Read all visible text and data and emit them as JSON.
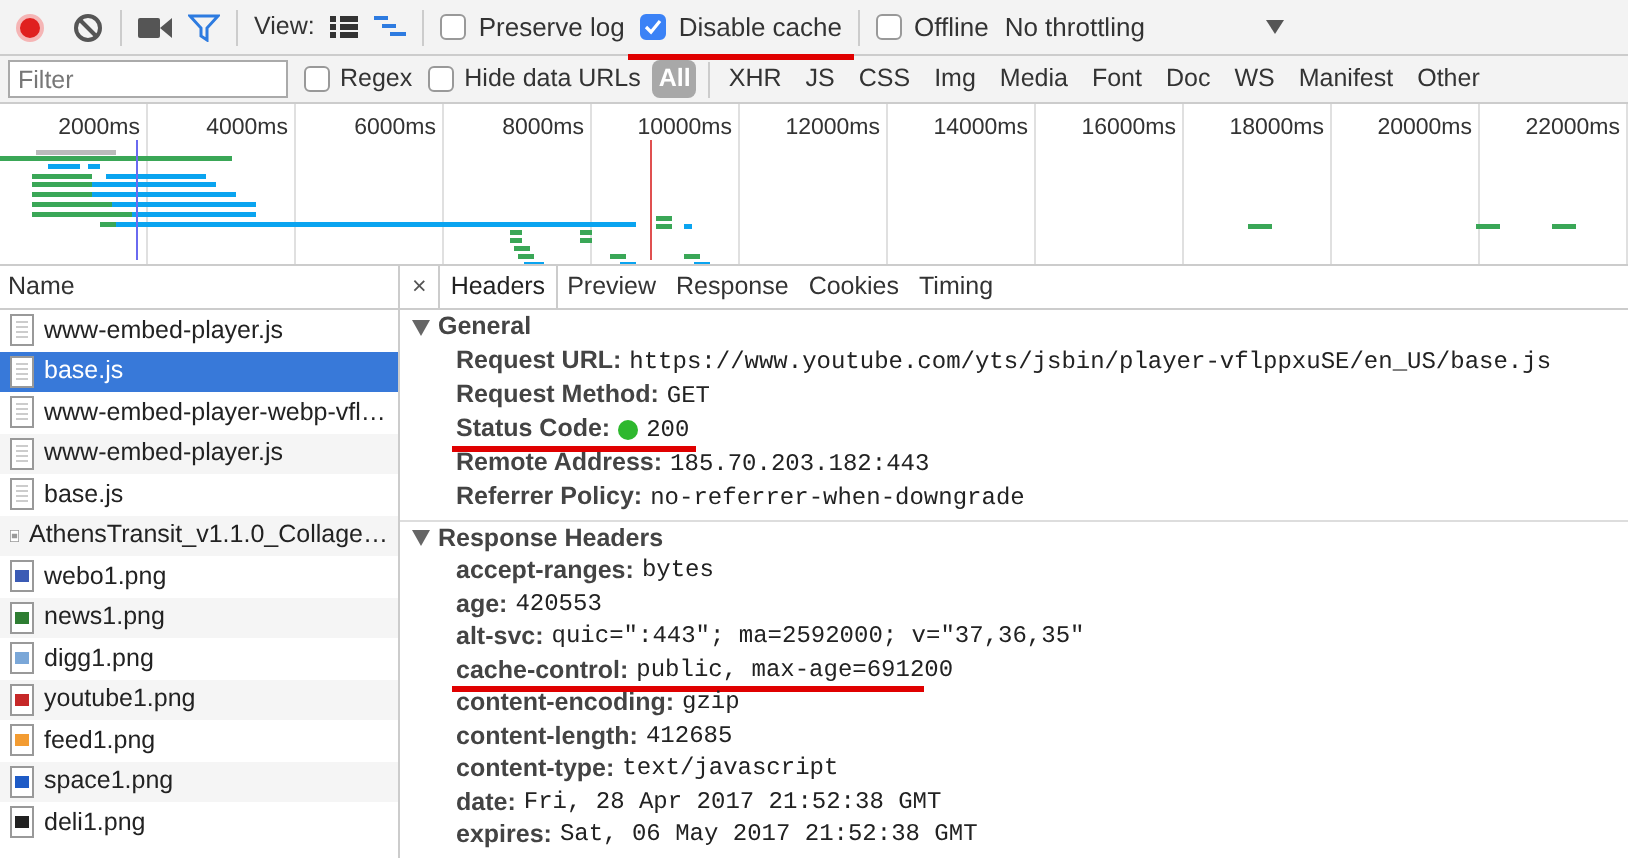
{
  "toolbar": {
    "recording": true,
    "view_label": "View:",
    "checkboxes": [
      {
        "label": "Preserve log",
        "checked": false
      },
      {
        "label": "Disable cache",
        "checked": true,
        "underlined": true
      },
      {
        "label": "Offline",
        "checked": false
      }
    ],
    "throttling": "No throttling"
  },
  "filter_bar": {
    "placeholder": "Filter",
    "checkboxes": [
      {
        "label": "Regex",
        "checked": false
      },
      {
        "label": "Hide data URLs",
        "checked": false
      }
    ],
    "types": [
      {
        "label": "All",
        "selected": true
      },
      {
        "label": "XHR",
        "selected": false
      },
      {
        "label": "JS",
        "selected": false
      },
      {
        "label": "CSS",
        "selected": false
      },
      {
        "label": "Img",
        "selected": false
      },
      {
        "label": "Media",
        "selected": false
      },
      {
        "label": "Font",
        "selected": false
      },
      {
        "label": "Doc",
        "selected": false
      },
      {
        "label": "WS",
        "selected": false
      },
      {
        "label": "Manifest",
        "selected": false
      },
      {
        "label": "Other",
        "selected": false
      }
    ]
  },
  "timeline": {
    "ticks": [
      "2000ms",
      "4000ms",
      "6000ms",
      "8000ms",
      "10000ms",
      "12000ms",
      "14000ms",
      "16000ms",
      "18000ms",
      "20000ms",
      "22000ms"
    ]
  },
  "requests": {
    "column": "Name",
    "rows": [
      {
        "name": "www-embed-player.js",
        "kind": "script",
        "selected": false
      },
      {
        "name": "base.js",
        "kind": "script",
        "selected": true
      },
      {
        "name": "www-embed-player-webp-vfl…",
        "kind": "script",
        "selected": false
      },
      {
        "name": "www-embed-player.js",
        "kind": "script",
        "selected": false
      },
      {
        "name": "base.js",
        "kind": "script",
        "selected": false
      },
      {
        "name": "AthensTransit_v1.1.0_Collage…",
        "kind": "image",
        "color": "#9a9a9a",
        "selected": false
      },
      {
        "name": "webo1.png",
        "kind": "image",
        "color": "#3b5bb5",
        "selected": false
      },
      {
        "name": "news1.png",
        "kind": "image",
        "color": "#2e7d32",
        "selected": false
      },
      {
        "name": "digg1.png",
        "kind": "image",
        "color": "#7aa7d8",
        "selected": false
      },
      {
        "name": "youtube1.png",
        "kind": "image",
        "color": "#c62828",
        "selected": false
      },
      {
        "name": "feed1.png",
        "kind": "image",
        "color": "#f39c32",
        "selected": false
      },
      {
        "name": "space1.png",
        "kind": "image",
        "color": "#1e5bc6",
        "selected": false
      },
      {
        "name": "deli1.png",
        "kind": "image",
        "color": "#222222",
        "selected": false
      }
    ]
  },
  "details": {
    "close": "×",
    "tabs": [
      {
        "label": "Headers",
        "selected": true
      },
      {
        "label": "Preview",
        "selected": false
      },
      {
        "label": "Response",
        "selected": false
      },
      {
        "label": "Cookies",
        "selected": false
      },
      {
        "label": "Timing",
        "selected": false
      }
    ],
    "sections": [
      {
        "title": "General",
        "expanded": true,
        "rows": [
          {
            "key": "Request URL:",
            "value": "https://www.youtube.com/yts/jsbin/player-vflppxuSE/en_US/base.js",
            "underlined": false
          },
          {
            "key": "Request Method:",
            "value": "GET",
            "underlined": false
          },
          {
            "key": "Status Code:",
            "value": "200",
            "color": "#2eb82e",
            "underlined": true
          },
          {
            "key": "Remote Address:",
            "value": "185.70.203.182:443",
            "underlined": false
          },
          {
            "key": "Referrer Policy:",
            "value": "no-referrer-when-downgrade",
            "underlined": false
          }
        ]
      },
      {
        "title": "Response Headers",
        "expanded": true,
        "rows": [
          {
            "key": "accept-ranges:",
            "value": "bytes",
            "underlined": false
          },
          {
            "key": "age:",
            "value": "420553",
            "underlined": false
          },
          {
            "key": "alt-svc:",
            "value": "quic=\":443\"; ma=2592000; v=\"37,36,35\"",
            "underlined": false
          },
          {
            "key": "cache-control:",
            "value": "public, max-age=691200",
            "underlined": true
          },
          {
            "key": "content-encoding:",
            "value": "gzip",
            "underlined": false
          },
          {
            "key": "content-length:",
            "value": "412685",
            "underlined": false
          },
          {
            "key": "content-type:",
            "value": "text/javascript",
            "underlined": false
          },
          {
            "key": "date:",
            "value": "Fri, 28 Apr 2017 21:52:38 GMT",
            "underlined": false
          },
          {
            "key": "expires:",
            "value": "Sat, 06 May 2017 21:52:38 GMT",
            "underlined": false
          }
        ]
      }
    ]
  }
}
